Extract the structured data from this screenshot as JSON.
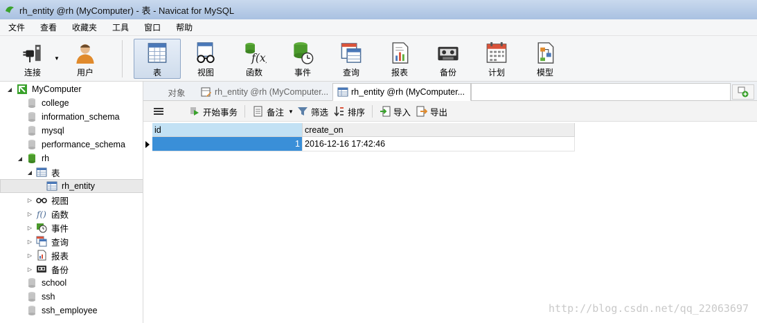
{
  "window": {
    "title": "rh_entity @rh (MyComputer) - 表 - Navicat for MySQL",
    "app_icon": "navicat-icon"
  },
  "menu": [
    "文件",
    "查看",
    "收藏夹",
    "工具",
    "窗口",
    "帮助"
  ],
  "toolbar": {
    "items": [
      {
        "label": "连接",
        "icon": "plug-icon"
      },
      {
        "label": "用户",
        "icon": "user-icon"
      },
      {
        "label": "表",
        "icon": "table-icon",
        "active": true
      },
      {
        "label": "视图",
        "icon": "glasses-icon"
      },
      {
        "label": "函数",
        "icon": "function-icon"
      },
      {
        "label": "事件",
        "icon": "event-icon"
      },
      {
        "label": "查询",
        "icon": "query-icon"
      },
      {
        "label": "报表",
        "icon": "report-icon"
      },
      {
        "label": "备份",
        "icon": "backup-icon"
      },
      {
        "label": "计划",
        "icon": "calendar-icon"
      },
      {
        "label": "模型",
        "icon": "model-icon"
      }
    ]
  },
  "sidebar": {
    "items": [
      {
        "label": "MyComputer",
        "icon": "server-icon"
      },
      {
        "label": "college",
        "icon": "database-icon"
      },
      {
        "label": "information_schema",
        "icon": "database-icon"
      },
      {
        "label": "mysql",
        "icon": "database-icon"
      },
      {
        "label": "performance_schema",
        "icon": "database-icon"
      },
      {
        "label": "rh",
        "icon": "database-open-icon"
      },
      {
        "label": "表",
        "icon": "table-icon"
      },
      {
        "label": "rh_entity",
        "icon": "table-icon"
      },
      {
        "label": "视图",
        "icon": "glasses-icon"
      },
      {
        "label": "函数",
        "icon": "function-icon"
      },
      {
        "label": "事件",
        "icon": "event-icon"
      },
      {
        "label": "查询",
        "icon": "query-icon"
      },
      {
        "label": "报表",
        "icon": "report-icon"
      },
      {
        "label": "备份",
        "icon": "backup-icon"
      },
      {
        "label": "school",
        "icon": "database-icon"
      },
      {
        "label": "ssh",
        "icon": "database-icon"
      },
      {
        "label": "ssh_employee",
        "icon": "database-icon"
      }
    ]
  },
  "tabs": [
    {
      "label": "对象"
    },
    {
      "label": "rh_entity @rh (MyComputer..."
    },
    {
      "label": "rh_entity @rh (MyComputer..."
    }
  ],
  "subtoolbar": {
    "menu_icon": "hamburger-icon",
    "begin_transaction": "开始事务",
    "memo": "备注",
    "filter": "筛选",
    "sort": "排序",
    "import": "导入",
    "export": "导出"
  },
  "grid": {
    "columns": [
      "id",
      "create_on"
    ],
    "rows": [
      [
        "1",
        "2016-12-16 17:42:46"
      ]
    ]
  },
  "watermark": "http://blog.csdn.net/qq_22063697"
}
